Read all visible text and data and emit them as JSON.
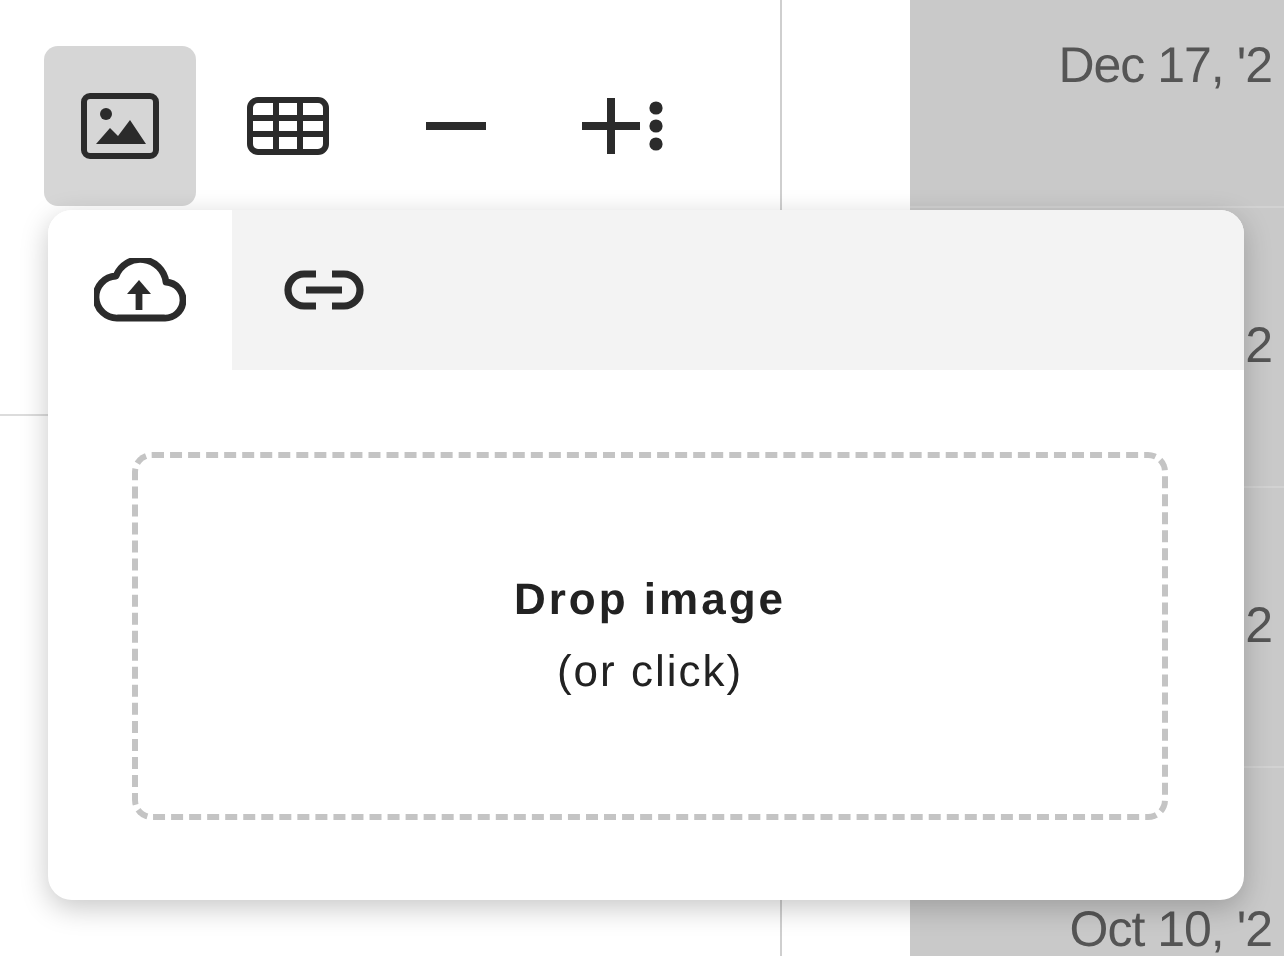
{
  "toolbar": {
    "buttons": [
      {
        "kind": "image",
        "selected": true
      },
      {
        "kind": "table",
        "selected": false
      },
      {
        "kind": "remove",
        "selected": false
      },
      {
        "kind": "add",
        "selected": false
      }
    ]
  },
  "date_column": [
    "Dec 17, '2",
    "2",
    "2",
    "Oct 10, '2"
  ],
  "popup": {
    "tabs": [
      {
        "kind": "upload",
        "selected": true
      },
      {
        "kind": "link",
        "selected": false
      }
    ],
    "drop_zone": {
      "title": "Drop image",
      "hint": "(or click)"
    }
  }
}
